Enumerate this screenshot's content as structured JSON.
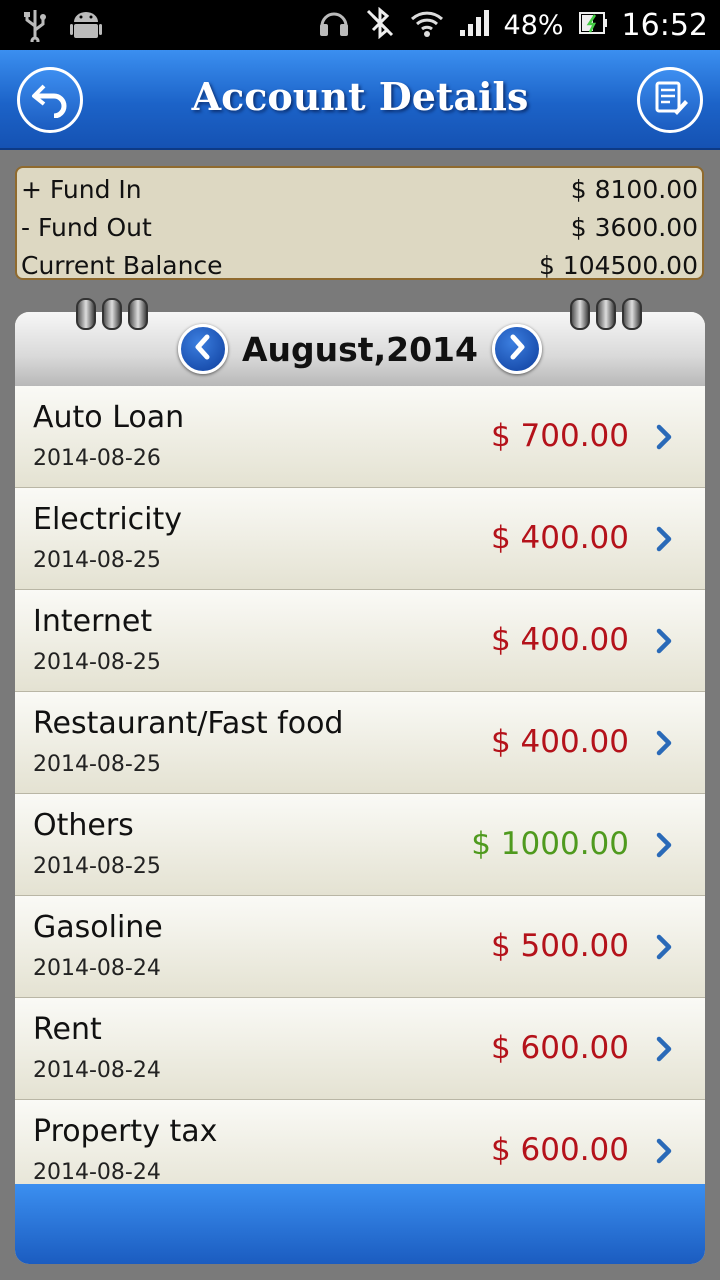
{
  "status_bar": {
    "battery": "48%",
    "time": "16:52",
    "icons": [
      "usb-icon",
      "android-icon",
      "headset-icon",
      "bluetooth-off-icon",
      "wifi-icon",
      "signal-icon",
      "battery-icon"
    ]
  },
  "header": {
    "title": "Account Details",
    "back_icon": "back-arrow-icon",
    "report_icon": "report-edit-icon"
  },
  "summary": {
    "fund_in_label": "+ Fund In",
    "fund_in_value": "$ 8100.00",
    "fund_out_label": "- Fund Out",
    "fund_out_value": "$ 3600.00",
    "balance_label": "Current Balance",
    "balance_value": "$ 104500.00"
  },
  "month_nav": {
    "label": "August,2014",
    "prev_icon": "chevron-left-icon",
    "next_icon": "chevron-right-icon"
  },
  "transactions": [
    {
      "title": "Auto Loan",
      "date": "2014-08-26",
      "amount": "$ 700.00",
      "type": "expense"
    },
    {
      "title": "Electricity",
      "date": "2014-08-25",
      "amount": "$ 400.00",
      "type": "expense"
    },
    {
      "title": "Internet",
      "date": "2014-08-25",
      "amount": "$ 400.00",
      "type": "expense"
    },
    {
      "title": "Restaurant/Fast food",
      "date": "2014-08-25",
      "amount": "$ 400.00",
      "type": "expense"
    },
    {
      "title": "Others",
      "date": "2014-08-25",
      "amount": "$ 1000.00",
      "type": "income"
    },
    {
      "title": "Gasoline",
      "date": "2014-08-24",
      "amount": "$ 500.00",
      "type": "expense"
    },
    {
      "title": "Rent",
      "date": "2014-08-24",
      "amount": "$ 600.00",
      "type": "expense"
    },
    {
      "title": "Property tax",
      "date": "2014-08-24",
      "amount": "$ 600.00",
      "type": "expense"
    }
  ],
  "colors": {
    "expense": "#b4121a",
    "income": "#4f9a1e",
    "header_blue": "#1c63c8"
  }
}
